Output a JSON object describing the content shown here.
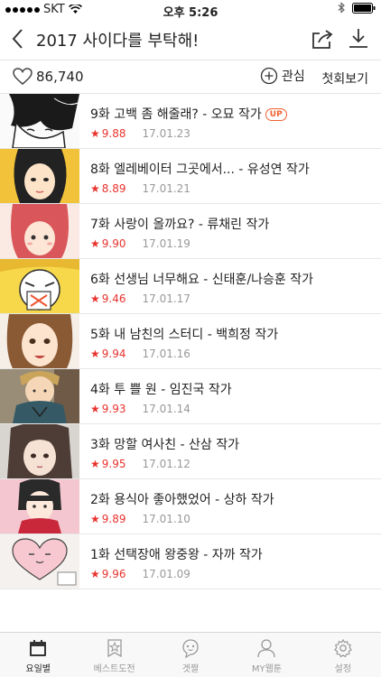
{
  "status_bar": {
    "carrier": "SKT",
    "time": "오후 5:26"
  },
  "nav": {
    "title": "2017 사이다를 부탁해!"
  },
  "info": {
    "likes": "86,740",
    "interest_label": "관심",
    "first_label": "첫회보기"
  },
  "episodes": [
    {
      "title": "9화 고백 좀 해줄래? - 오묘 작가",
      "badge": "UP",
      "rating": "9.88",
      "date": "17.01.23"
    },
    {
      "title": "8화 엘레베이터 그곳에서... - 유성연 작가",
      "rating": "8.89",
      "date": "17.01.21"
    },
    {
      "title": "7화 사랑이 올까요? - 류채린 작가",
      "rating": "9.90",
      "date": "17.01.19"
    },
    {
      "title": "6화 선생님 너무해요 - 신태훈/나승훈 작가",
      "rating": "9.46",
      "date": "17.01.17"
    },
    {
      "title": "5화 내 남친의 스터디 - 백희정 작가",
      "rating": "9.94",
      "date": "17.01.16"
    },
    {
      "title": "4화 투 쁠 원 - 임진국 작가",
      "rating": "9.93",
      "date": "17.01.14"
    },
    {
      "title": "3화 망할 여사친 - 산삼 작가",
      "rating": "9.95",
      "date": "17.01.12"
    },
    {
      "title": "2화 용식아 좋아했었어 - 상하 작가",
      "rating": "9.89",
      "date": "17.01.10"
    },
    {
      "title": "1화 선택장애 왕중왕 - 자까 작가",
      "rating": "9.96",
      "date": "17.01.09"
    }
  ],
  "tabs": [
    {
      "label": "요일별",
      "icon": "calendar-icon",
      "active": true
    },
    {
      "label": "베스트도전",
      "icon": "best-challenge-icon",
      "active": false
    },
    {
      "label": "겟짤",
      "icon": "getzzal-icon",
      "active": false
    },
    {
      "label": "MY웹툰",
      "icon": "person-icon",
      "active": false
    },
    {
      "label": "설정",
      "icon": "gear-icon",
      "active": false
    }
  ],
  "colors": {
    "accent": "#e8332e",
    "up_badge": "#f06030",
    "date": "#999999"
  }
}
